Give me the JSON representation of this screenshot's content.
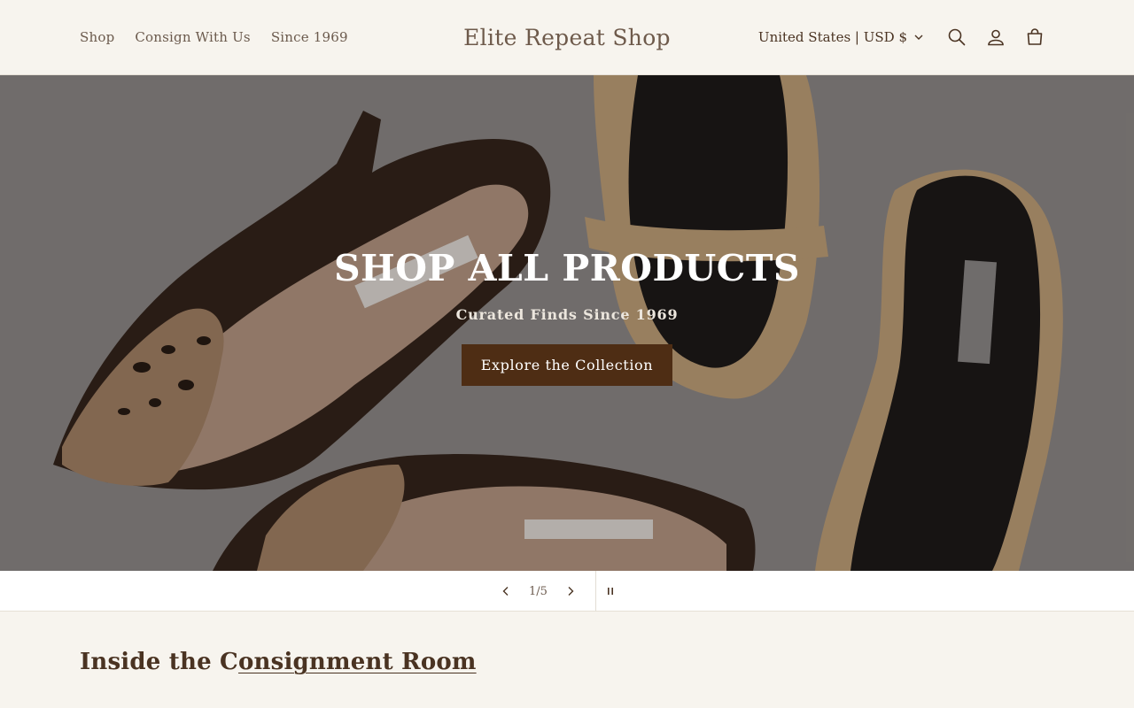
{
  "header": {
    "nav": [
      "Shop",
      "Consign With Us",
      "Since 1969"
    ],
    "brand": "Elite Repeat Shop",
    "locale": "United States | USD $",
    "icons": [
      "search-icon",
      "account-icon",
      "cart-icon"
    ]
  },
  "hero": {
    "title": "SHOP ALL PRODUCTS",
    "subtitle": "Curated Finds Since 1969",
    "cta": "Explore the Collection"
  },
  "slider": {
    "counter": "1/5",
    "prev_icon": "chevron-left-icon",
    "next_icon": "chevron-right-icon",
    "pause_icon": "pause-icon"
  },
  "section": {
    "title_plain": "Inside the C",
    "title_link": "onsignment Room"
  },
  "colors": {
    "background": "#f7f4ee",
    "text": "#4a3322",
    "button": "#4e2d14",
    "hero_bg": "#8c8a8a"
  }
}
